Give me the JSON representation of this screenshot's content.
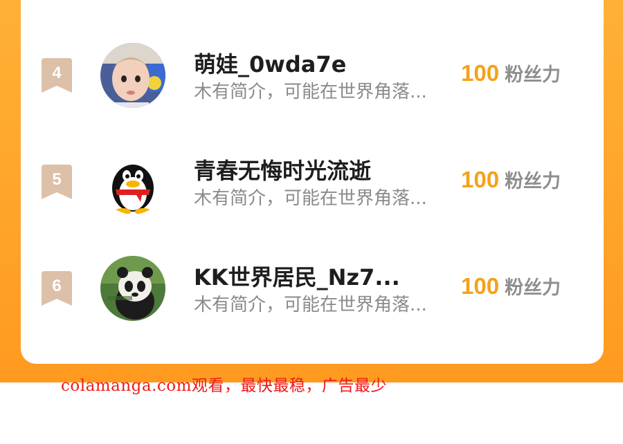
{
  "ranking": [
    {
      "rank": "4",
      "avatar_icon": "child-photo-avatar",
      "name": "萌娃_0wda7e",
      "bio": "木有简介，可能在世界角落...",
      "score": "100",
      "score_label": "粉丝力"
    },
    {
      "rank": "5",
      "avatar_icon": "qq-penguin-avatar",
      "name": "青春无悔时光流逝",
      "bio": "木有简介，可能在世界角落...",
      "score": "100",
      "score_label": "粉丝力"
    },
    {
      "rank": "6",
      "avatar_icon": "panda-photo-avatar",
      "name": "KK世界居民_Nz7...",
      "bio": "木有简介，可能在世界角落...",
      "score": "100",
      "score_label": "粉丝力"
    }
  ],
  "watermark": "colamanga.com观看，最快最稳，广告最少",
  "colors": {
    "accent_orange": "#ff9a1f",
    "score": "#f3a21a",
    "badge": "#d9b8a0",
    "watermark": "#ee1a1a"
  }
}
